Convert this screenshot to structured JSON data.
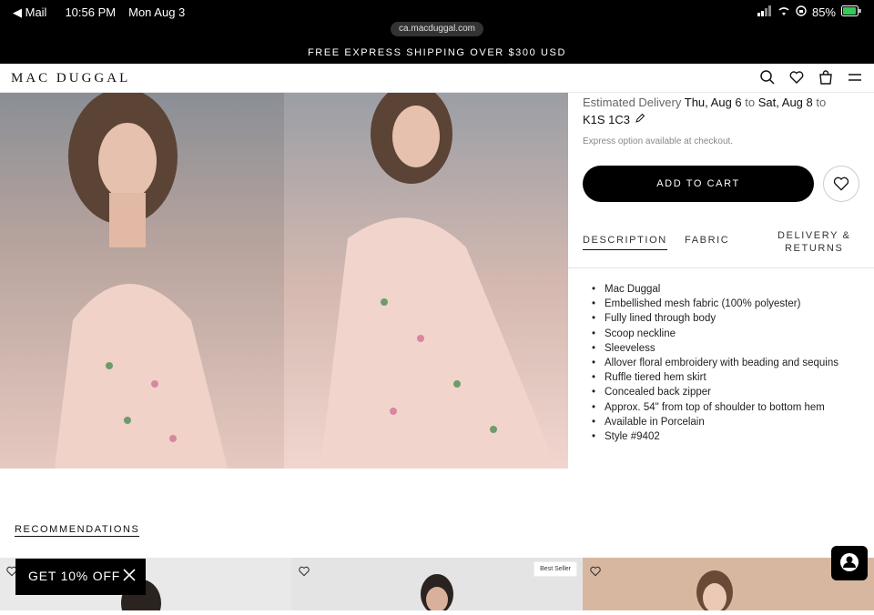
{
  "status_bar": {
    "back_app": "◀ Mail",
    "time": "10:56 PM",
    "date": "Mon Aug 3",
    "url": "ca.macduggal.com",
    "battery": "85%"
  },
  "promo": {
    "text": "FREE EXPRESS SHIPPING OVER $300 USD"
  },
  "nav": {
    "logo": "MAC DUGGAL"
  },
  "delivery": {
    "prefix": "Estimated Delivery",
    "from_date": "Thu, Aug 6",
    "to_word": "to",
    "to_date": "Sat, Aug 8",
    "to_word2": "to",
    "postal": "K1S 1C3",
    "express_note": "Express option available at checkout."
  },
  "cart": {
    "button": "ADD TO CART"
  },
  "tabs": {
    "description": "DESCRIPTION",
    "fabric": "FABRIC",
    "delivery_line1": "DELIVERY &",
    "delivery_line2": "RETURNS"
  },
  "description_items": [
    "Mac Duggal",
    "Embellished mesh fabric (100% polyester)",
    "Fully lined through body",
    "Scoop neckline",
    "Sleeveless",
    "Allover floral embroidery with beading and sequins",
    "Ruffle tiered hem skirt",
    "Concealed back zipper",
    "Approx. 54\" from top of shoulder to bottom hem",
    "Available in Porcelain",
    "Style #9402"
  ],
  "recommendations": {
    "title": "RECOMMENDATIONS",
    "badge": "Best Seller"
  },
  "discount_popup": {
    "label": "GET 10% OFF"
  }
}
